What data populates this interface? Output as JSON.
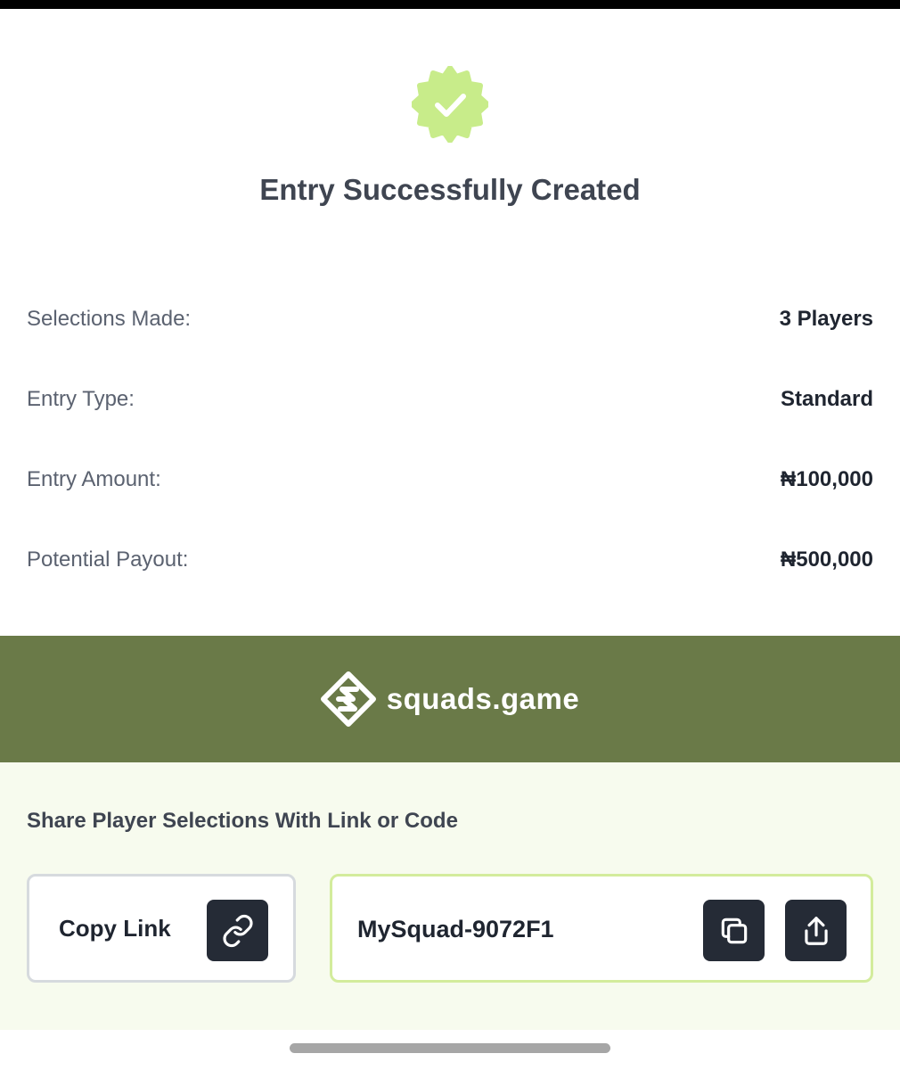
{
  "confirmation": {
    "icon": "check-badge-icon",
    "title": "Entry Successfully Created"
  },
  "summary": [
    {
      "label": "Selections Made:",
      "value": "3 Players"
    },
    {
      "label": "Entry Type:",
      "value": "Standard"
    },
    {
      "label": "Entry Amount:",
      "value": "₦100,000"
    },
    {
      "label": "Potential Payout:",
      "value": "₦500,000"
    }
  ],
  "brand": {
    "name": "squads.game",
    "logo_icon": "squads-logo-icon"
  },
  "share": {
    "title": "Share Player Selections With Link or Code",
    "copy_link_label": "Copy Link",
    "copy_link_icon": "link-icon",
    "code": "MySquad-9072F1",
    "copy_code_icon": "copy-icon",
    "share_icon": "share-icon"
  },
  "colors": {
    "badge": "#c8ec8a",
    "brand_bar": "#6a7a48",
    "share_panel": "#f7fbee",
    "button_dark": "#252b36",
    "code_border": "#d3ec9c"
  }
}
